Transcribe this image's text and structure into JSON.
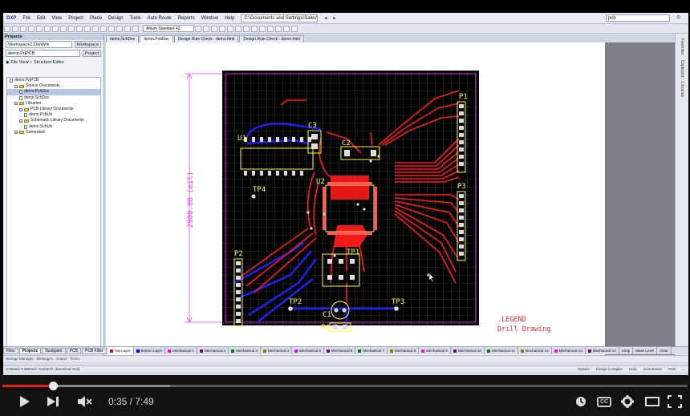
{
  "menu": {
    "logo": "DXP",
    "items": [
      "File",
      "Edit",
      "View",
      "Project",
      "Place",
      "Design",
      "Tools",
      "Auto Route",
      "Reports",
      "Window",
      "Help"
    ],
    "path": "C:\\Documents and Settings\\Sales\\Pri",
    "search_placeholder": "pcb"
  },
  "toolbar": {
    "layer_select": "Altium Standard 42"
  },
  "doc_tabs": [
    "demo.SchDoc",
    "demo.PcbDoc",
    "Design Rule Check - demo.html",
    "Design Rule Check - demo.html"
  ],
  "projects_panel": {
    "title": "Projects",
    "workspace_value": "Workspace1.DsnWrk",
    "workspace_button": "Workspace",
    "project_value": "demo.PrjPCB",
    "project_button": "Project",
    "view_file": "File View",
    "view_structure": "Structure Editor",
    "tree": [
      {
        "label": "demo.PrjPCB",
        "level": 0,
        "kind": "doc",
        "selected": false
      },
      {
        "label": "Source Documents",
        "level": 1,
        "kind": "folder",
        "selected": false
      },
      {
        "label": "demo.PcbDoc",
        "level": 2,
        "kind": "doc",
        "selected": true
      },
      {
        "label": "demo.SchDoc",
        "level": 2,
        "kind": "doc",
        "selected": false
      },
      {
        "label": "Libraries",
        "level": 1,
        "kind": "folder",
        "selected": false
      },
      {
        "label": "PCB Library Documents",
        "level": 2,
        "kind": "folder",
        "selected": false
      },
      {
        "label": "demo.PcbLib",
        "level": 3,
        "kind": "doc",
        "selected": false
      },
      {
        "label": "Schematic Library Documents",
        "level": 2,
        "kind": "folder",
        "selected": false
      },
      {
        "label": "demo.SchLib",
        "level": 3,
        "kind": "doc",
        "selected": false
      },
      {
        "label": "Generated",
        "level": 1,
        "kind": "folder",
        "selected": false
      }
    ]
  },
  "right_strip": [
    "Favorites",
    "Clipboard",
    "Libraries"
  ],
  "pcb": {
    "dimension": "2900.00 (mil)",
    "legend_1": ".LEGEND",
    "legend_2": "Drill Drawing",
    "refdes": [
      "P1",
      "U1",
      "C3",
      "C2",
      "U2",
      "TP4",
      "P3",
      "P2",
      "TP1",
      "TP2",
      "TP3",
      "C1",
      "P4"
    ]
  },
  "colors": {
    "board": "#000000",
    "top_layer": "#ff0000",
    "bottom_layer": "#0000ff",
    "overlay": "#ffff00",
    "dimension": "#ff3aff",
    "grid": "#6a6a6a"
  },
  "panel_tabs": [
    "Files",
    "Projects",
    "Navigator",
    "PCB",
    "PCB Filter"
  ],
  "layer_tabs": [
    {
      "name": "Top Layer",
      "color": "#ff0000"
    },
    {
      "name": "Bottom Layer",
      "color": "#0000ff"
    },
    {
      "name": "Mechanical 1",
      "color": "#ff00ff"
    },
    {
      "name": "Mechanical 2",
      "color": "#800080"
    },
    {
      "name": "Mechanical 3",
      "color": "#008000"
    },
    {
      "name": "Mechanical 4",
      "color": "#808000"
    },
    {
      "name": "Mechanical 5",
      "color": "#ff00ff"
    },
    {
      "name": "Mechanical 6",
      "color": "#800080"
    },
    {
      "name": "Mechanical 7",
      "color": "#008000"
    },
    {
      "name": "Mechanical 8",
      "color": "#808000"
    },
    {
      "name": "Mechanical 9",
      "color": "#ff00ff"
    },
    {
      "name": "Mechanical 10",
      "color": "#800080"
    },
    {
      "name": "Mechanical 11",
      "color": "#008000"
    },
    {
      "name": "Mechanical 12",
      "color": "#808000"
    },
    {
      "name": "Mechanical 13",
      "color": "#ff00ff"
    },
    {
      "name": "Mechanical 14",
      "color": "#800080"
    }
  ],
  "layer_tail": [
    "Snap",
    "Mask Level",
    "Clear"
  ],
  "status_top": [
    "Storage Manager",
    "Messages",
    "Output",
    "To-Do"
  ],
  "status_bottom": {
    "coords": "X:900mil Y:4600mil",
    "grid": "Grid:5mil",
    "mode": "(Electrical Grid)",
    "right": [
      "System",
      "Design Compiler",
      "Help",
      "Instruments",
      "PCB",
      "..."
    ]
  },
  "player": {
    "current_time": "0:35",
    "duration": "7:49",
    "progress_fraction": 0.075,
    "buffered_fraction": 0.245,
    "cc_label": "CC"
  }
}
